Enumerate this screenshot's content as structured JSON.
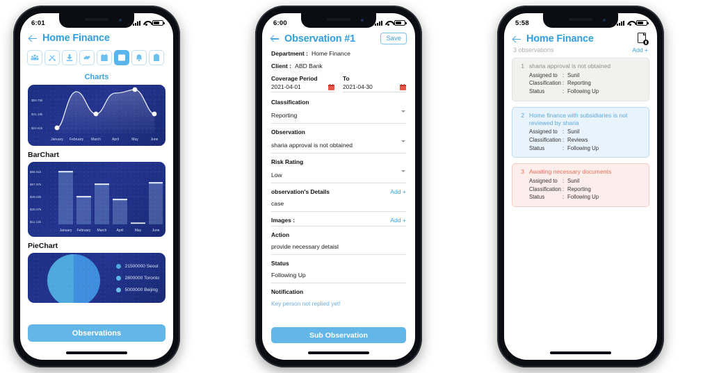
{
  "colors": {
    "accent": "#3aa3e2",
    "button": "#63b6e8",
    "chart_bg_dark": "#1b2f82",
    "card_grey": "#f1f1ef",
    "card_blue": "#e9f3fc",
    "card_red": "#fdeeeb",
    "text_grey": "#8d8d8a",
    "text_blue": "#5ba8e0",
    "text_red": "#e2705b"
  },
  "phone1": {
    "status": {
      "time": "6:01",
      "signal_icon": "signal-bars-icon",
      "wifi_icon": "wifi-icon",
      "battery_icon": "battery-icon"
    },
    "header": {
      "back_icon": "back-arrow-icon",
      "title": "Home Finance"
    },
    "toolbar": [
      {
        "name": "team-icon",
        "label": "Team",
        "active": false
      },
      {
        "name": "tools-icon",
        "label": "Tools",
        "active": false
      },
      {
        "name": "download-icon",
        "label": "Download",
        "active": false
      },
      {
        "name": "link-icon",
        "label": "Link",
        "active": false
      },
      {
        "name": "calendar-icon",
        "label": "Calendar",
        "active": false
      },
      {
        "name": "chart-icon",
        "label": "Charts",
        "active": true
      },
      {
        "name": "bell-icon",
        "label": "Notifications",
        "active": false
      },
      {
        "name": "clipboard-icon",
        "label": "Clipboard",
        "active": false
      }
    ],
    "charts_title": "Charts",
    "barchart_title": "BarChart",
    "piechart_title": "PieChart",
    "observations_button": "Observations"
  },
  "phone2": {
    "status": {
      "time": "6:00"
    },
    "header": {
      "back_icon": "back-arrow-icon",
      "title": "Observation #1",
      "save_label": "Save"
    },
    "department": {
      "label": "Department :",
      "value": "Home Finance"
    },
    "client": {
      "label": "Client :",
      "value": "ABD Bank"
    },
    "coverage": {
      "from_label": "Coverage Period",
      "from_value": "2021-04-01",
      "to_label": "To",
      "to_value": "2021-04-30",
      "calendar_icon": "calendar-icon"
    },
    "classification": {
      "label": "Classification",
      "value": "Reporting"
    },
    "observation": {
      "label": "Observation",
      "value": "sharia approval is not obtained"
    },
    "risk_rating": {
      "label": "Risk Rating",
      "value": "Low"
    },
    "details": {
      "label": "observation's Details",
      "add_label": "Add +",
      "value": "case"
    },
    "images": {
      "label": "Images :",
      "add_label": "Add +"
    },
    "action": {
      "label": "Action",
      "value": "provide necessary detaisl"
    },
    "status_field": {
      "label": "Status",
      "value": "Following Up"
    },
    "notification": {
      "label": "Notification",
      "value": "Key person not replied yet!"
    },
    "sub_observation_button": "Sub Observation"
  },
  "phone3": {
    "status": {
      "time": "5:58"
    },
    "header": {
      "back_icon": "back-arrow-icon",
      "title": "Home Finance",
      "doc_icon": "document-download-icon"
    },
    "count_label": "3 observations",
    "add_label": "Add +",
    "field_labels": {
      "assigned": "Assigned to",
      "classification": "Classification",
      "status": "Status",
      "sep": ":"
    },
    "observations": [
      {
        "num": "1",
        "title": "sharia approval is not obtained",
        "assigned": "Sunil",
        "classification": "Reporting",
        "status": "Following Up"
      },
      {
        "num": "2",
        "title": "Home finance with subsidiaries is not reviewed by sharia",
        "assigned": "Sunil",
        "classification": "Reviews",
        "status": "Following Up"
      },
      {
        "num": "3",
        "title": "Awaiting necessary documents",
        "assigned": "Sunil",
        "classification": "Reporting",
        "status": "Following Up"
      }
    ]
  },
  "chart_data": [
    {
      "type": "line",
      "title": "Charts",
      "categories": [
        "January",
        "February",
        "March",
        "April",
        "May",
        "June"
      ],
      "values": [
        22.61,
        68.0,
        50.0,
        66.0,
        75.5,
        42.0
      ],
      "ytick_labels": [
        "$59.75k",
        "$41.18k",
        "$22.61k"
      ],
      "ytick_values": [
        59.75,
        41.18,
        22.61
      ],
      "marker_points": [
        {
          "x": "January",
          "y": 22.61
        },
        {
          "x": "March",
          "y": 50.0
        },
        {
          "x": "May",
          "y": 75.5
        },
        {
          "x": "June",
          "y": 42.0
        }
      ],
      "xlabel": "",
      "ylabel": "",
      "ylim": [
        14,
        84
      ],
      "grid": true,
      "legend": "none"
    },
    {
      "type": "bar",
      "title": "BarChart",
      "categories": [
        "January",
        "February",
        "March",
        "April",
        "May",
        "June"
      ],
      "values": [
        86.91,
        49.02,
        67.97,
        45.5,
        5.0,
        70.5
      ],
      "ytick_labels": [
        "$86.91k",
        "$67.97k",
        "$49.02k",
        "$30.07k",
        "$11.13k"
      ],
      "ytick_values": [
        86.91,
        67.97,
        49.02,
        30.07,
        11.13
      ],
      "xlabel": "",
      "ylabel": "",
      "ylim": [
        0,
        92
      ],
      "grid": true,
      "legend": "none"
    },
    {
      "type": "pie",
      "title": "PieChart",
      "labels": [
        "Seoul",
        "Toronto",
        "Beijing"
      ],
      "values": [
        21500000,
        2800000,
        5000000
      ],
      "legend_entries": [
        "21500000 Seoul",
        "2800000 Toronto",
        "5000000 Beijing"
      ],
      "legend_position": "right",
      "slice_colors": [
        "#4ea7dd",
        "#3f8ede",
        "#5cb3e6"
      ]
    }
  ]
}
